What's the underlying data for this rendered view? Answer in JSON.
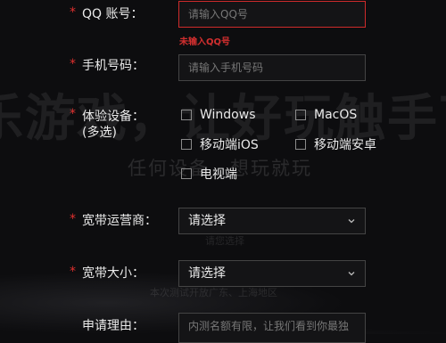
{
  "background": {
    "headline": "乐游戏，让好玩触手可及",
    "subline": "任何设备，想玩就玩",
    "small1": "请您选择",
    "small2": "本次测试开放广东、上海地区"
  },
  "form": {
    "qq": {
      "required": "*",
      "label": "QQ 账号：",
      "placeholder": "请输入QQ号",
      "error": "未输入QQ号"
    },
    "phone": {
      "required": "*",
      "label": "手机号码：",
      "placeholder": "请输入手机号码"
    },
    "device": {
      "required": "*",
      "label_line1": "体验设备：",
      "label_line2": "(多选)",
      "options": [
        "Windows",
        "MacOS",
        "移动端iOS",
        "移动端安卓",
        "电视端"
      ]
    },
    "isp": {
      "required": "*",
      "label": "宽带运营商：",
      "value": "请选择"
    },
    "bandwidth": {
      "required": "*",
      "label": "宽带大小：",
      "value": "请选择"
    },
    "reason": {
      "label": "申请理由：",
      "placeholder": "内测名额有限，让我们看到你最独"
    }
  },
  "colors": {
    "required": "#e0302e",
    "error_border": "#cf2b2b",
    "background": "#0d0d0f"
  },
  "icons": {
    "dropdown": "chevron-down-icon"
  }
}
